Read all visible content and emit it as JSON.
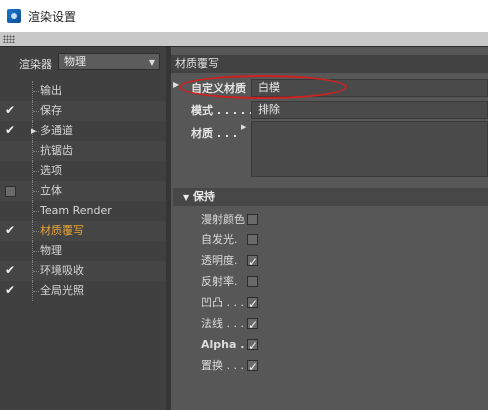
{
  "window": {
    "title": "渲染设置"
  },
  "sidebar": {
    "renderer_label": "渲染器",
    "renderer_value": "物理",
    "items": [
      {
        "label": "输出",
        "checked": null,
        "active": false
      },
      {
        "label": "保存",
        "checked": true,
        "active": false
      },
      {
        "label": "多通道",
        "checked": true,
        "active": false,
        "expandable": true
      },
      {
        "label": "抗锯齿",
        "checked": null,
        "active": false
      },
      {
        "label": "选项",
        "checked": null,
        "active": false
      },
      {
        "label": "立体",
        "checked": false,
        "active": false
      },
      {
        "label": "Team Render",
        "checked": null,
        "active": false
      },
      {
        "label": "材质覆写",
        "checked": true,
        "active": true
      },
      {
        "label": "物理",
        "checked": null,
        "active": false
      },
      {
        "label": "环境吸收",
        "checked": true,
        "active": false
      },
      {
        "label": "全局光照",
        "checked": true,
        "active": false
      }
    ]
  },
  "panel": {
    "header": "材质覆写",
    "custom_material_label": "自定义材质",
    "custom_material_value": "白模",
    "mode_label": "模式 . . . . .",
    "mode_value": "排除",
    "material_label": "材质 . . .",
    "section_title": "保持",
    "keep_options": [
      {
        "label": "漫射颜色",
        "checked": false
      },
      {
        "label": "自发光.",
        "checked": false
      },
      {
        "label": "透明度.",
        "checked": true
      },
      {
        "label": "反射率.",
        "checked": false
      },
      {
        "label": "凹凸 . . .",
        "checked": true
      },
      {
        "label": "法线 . . .",
        "checked": true
      },
      {
        "label": "Alpha . .",
        "checked": true
      },
      {
        "label": "置换 . . .",
        "checked": true
      }
    ]
  },
  "colors": {
    "active_item": "#e8a43a",
    "annotation": "#d02020"
  }
}
